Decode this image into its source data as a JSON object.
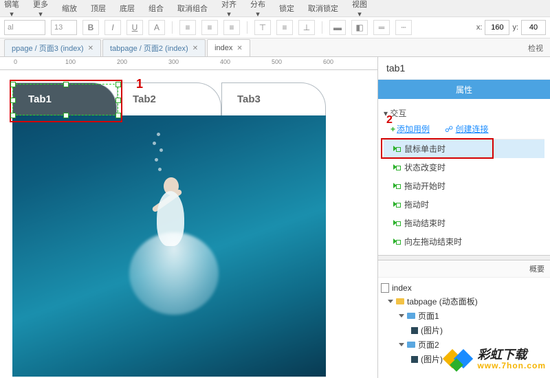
{
  "toolbar": {
    "items": [
      "钢笔",
      "更多",
      "缩放",
      "顶层",
      "底层",
      "组合",
      "取消组合",
      "对齐",
      "分布",
      "锁定",
      "取消锁定",
      "视图"
    ]
  },
  "format": {
    "font_placeholder": "al",
    "size": "13",
    "coord_x_label": "x:",
    "coord_x": "160",
    "coord_y_label": "y:",
    "coord_y": "40"
  },
  "file_tabs": [
    {
      "label": "ppage / 页面3 (index)",
      "active": false
    },
    {
      "label": "tabpage / 页面2 (index)",
      "active": false
    },
    {
      "label": "index",
      "active": true
    }
  ],
  "ruler": [
    "0",
    "100",
    "200",
    "300",
    "400",
    "500",
    "600"
  ],
  "canvas_tabs": {
    "t1": "Tab1",
    "t2": "Tab2",
    "t3": "Tab3"
  },
  "annotations": {
    "one": "1",
    "two": "2"
  },
  "inspector": {
    "selection_name": "tab1",
    "tab_props": "属性",
    "right_label": "检视",
    "section_interaction": "交互",
    "add_case": "添加用例",
    "create_link": "创建连接",
    "events": [
      "鼠标单击时",
      "状态改变时",
      "拖动开始时",
      "拖动时",
      "拖动结束时",
      "向左拖动结束时"
    ]
  },
  "outline": {
    "head": "概要",
    "root": "index",
    "panel": "tabpage (动态面板)",
    "page1": "页面1",
    "img1": "(图片)",
    "page2": "页面2",
    "img2": "(图片)"
  },
  "watermark": {
    "line1": "彩虹下载",
    "line2": "www.7hon.com"
  }
}
